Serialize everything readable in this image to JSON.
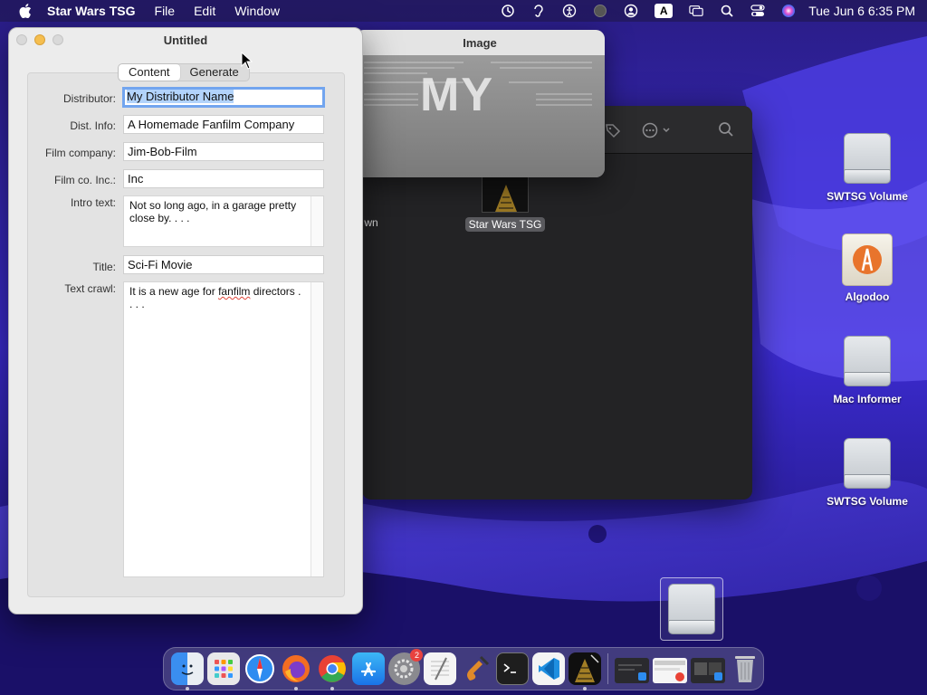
{
  "menubar": {
    "app_name": "Star Wars TSG",
    "menus": [
      "File",
      "Edit",
      "Window"
    ],
    "clock": "Tue Jun 6  6:35 PM",
    "status_icons": [
      "time-machine-icon",
      "hearing-icon",
      "accessibility-icon",
      "vpn-icon",
      "user-icon",
      "input-source-icon",
      "screen-mirroring-icon",
      "spotlight-search-icon",
      "control-center-icon",
      "siri-icon"
    ]
  },
  "main_window": {
    "title": "Untitled",
    "tabs": [
      "Content",
      "Generate"
    ],
    "active_tab": "Content",
    "fields": {
      "distributor": {
        "label": "Distributor:",
        "value": "My Distributor Name"
      },
      "dist_info": {
        "label": "Dist. Info:",
        "value": "A Homemade Fanfilm Company"
      },
      "film_company": {
        "label": "Film company:",
        "value": "Jim-Bob-Film"
      },
      "film_co_inc": {
        "label": "Film co. Inc.:",
        "value": "Inc"
      },
      "intro_text": {
        "label": "Intro text:",
        "value": "Not so long ago, in a garage pretty close by. . . ."
      },
      "title": {
        "label": "Title:",
        "value": "Sci-Fi Movie"
      },
      "text_crawl": {
        "label": "Text crawl:",
        "value_before": "It is a new age for ",
        "value_misspelled": "fanfilm",
        "value_after": " directors . . . ."
      }
    }
  },
  "image_window": {
    "title": "Image",
    "big_text": "MY"
  },
  "finder_window": {
    "file_name": "Star Wars TSG",
    "partial_label": "wn"
  },
  "desktop_icons": [
    {
      "label": "SWTSG Volume",
      "type": "drive"
    },
    {
      "label": "Algodoo",
      "type": "app"
    },
    {
      "label": "Mac Informer",
      "type": "drive"
    },
    {
      "label": "SWTSG Volume",
      "type": "drive"
    }
  ],
  "dock": {
    "apps": [
      "finder-icon",
      "launchpad-icon",
      "safari-icon",
      "firefox-icon",
      "chrome-icon",
      "app-store-icon",
      "system-settings-icon",
      "textedit-icon",
      "garageband-icon",
      "terminal-icon",
      "vscode-icon",
      "star-wars-tsg-icon"
    ],
    "settings_badge": "2",
    "colors": {
      "accent": "#72a5ef",
      "badge": "#e8423f"
    }
  }
}
